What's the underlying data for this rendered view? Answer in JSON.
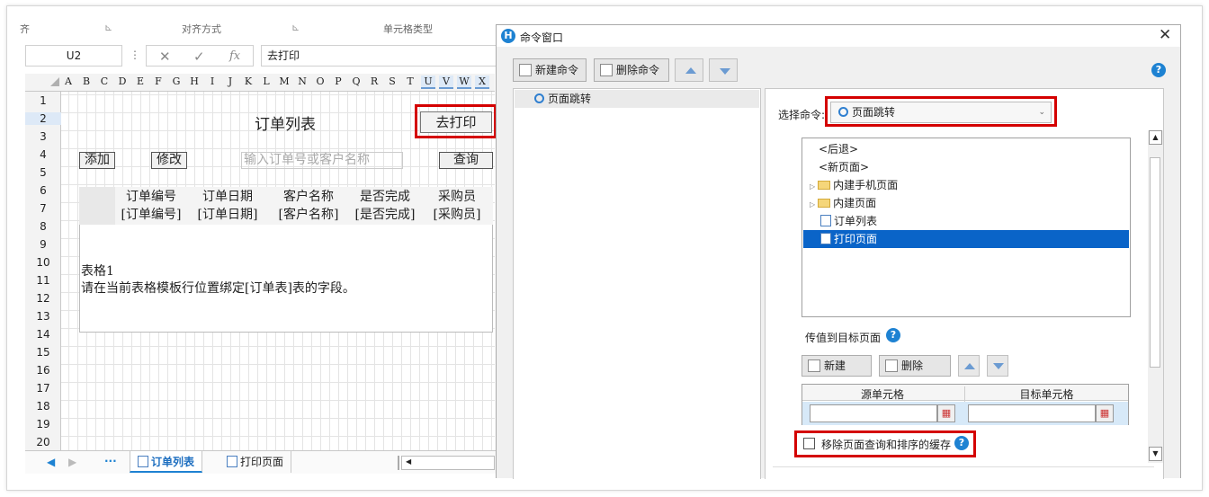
{
  "ribbon": {
    "left": "齐",
    "mid1": "对齐方式",
    "mid2": "单元格类型"
  },
  "formula_bar": {
    "name_box": "U2",
    "fx": "fx",
    "content": "去打印"
  },
  "columns": [
    "A",
    "B",
    "C",
    "D",
    "E",
    "F",
    "G",
    "H",
    "I",
    "J",
    "K",
    "L",
    "M",
    "N",
    "O",
    "P",
    "Q",
    "R",
    "S",
    "T",
    "U",
    "V",
    "W",
    "X"
  ],
  "rows": [
    "1",
    "2",
    "3",
    "4",
    "5",
    "6",
    "7",
    "8",
    "9",
    "10",
    "11",
    "12",
    "13",
    "14",
    "15",
    "16",
    "17",
    "18",
    "19",
    "20"
  ],
  "sheet": {
    "title": "订单列表",
    "print_button": "去打印",
    "add_button": "添加",
    "edit_button": "修改",
    "search_placeholder": "输入订单号或客户名称",
    "query_button": "查询",
    "headers": [
      "订单编号",
      "订单日期",
      "客户名称",
      "是否完成",
      "采购员"
    ],
    "data_row": [
      "[订单编号]",
      "[订单日期]",
      "[客户名称]",
      "[是否完成]",
      "[采购员]"
    ],
    "table_name": "表格1",
    "table_hint": "请在当前表格模板行位置绑定[订单表]表的字段。"
  },
  "tabs": {
    "ellipsis": "···",
    "tab1": "订单列表",
    "tab2": "打印页面"
  },
  "dialog": {
    "title": "命令窗口",
    "new_cmd": "新建命令",
    "del_cmd": "删除命令",
    "cmd_item": "页面跳转",
    "select_label": "选择命令:",
    "select_value": "页面跳转",
    "tree": {
      "back": "<后退>",
      "newpage": "<新页面>",
      "mobile": "内建手机页面",
      "builtin": "内建页面",
      "p1": "订单列表",
      "p2": "打印页面"
    },
    "pass_label": "传值到目标页面",
    "new_btn": "新建",
    "del_btn": "删除",
    "col_src": "源单元格",
    "col_dst": "目标单元格",
    "remove_cache": "移除页面查询和排序的缓存"
  }
}
